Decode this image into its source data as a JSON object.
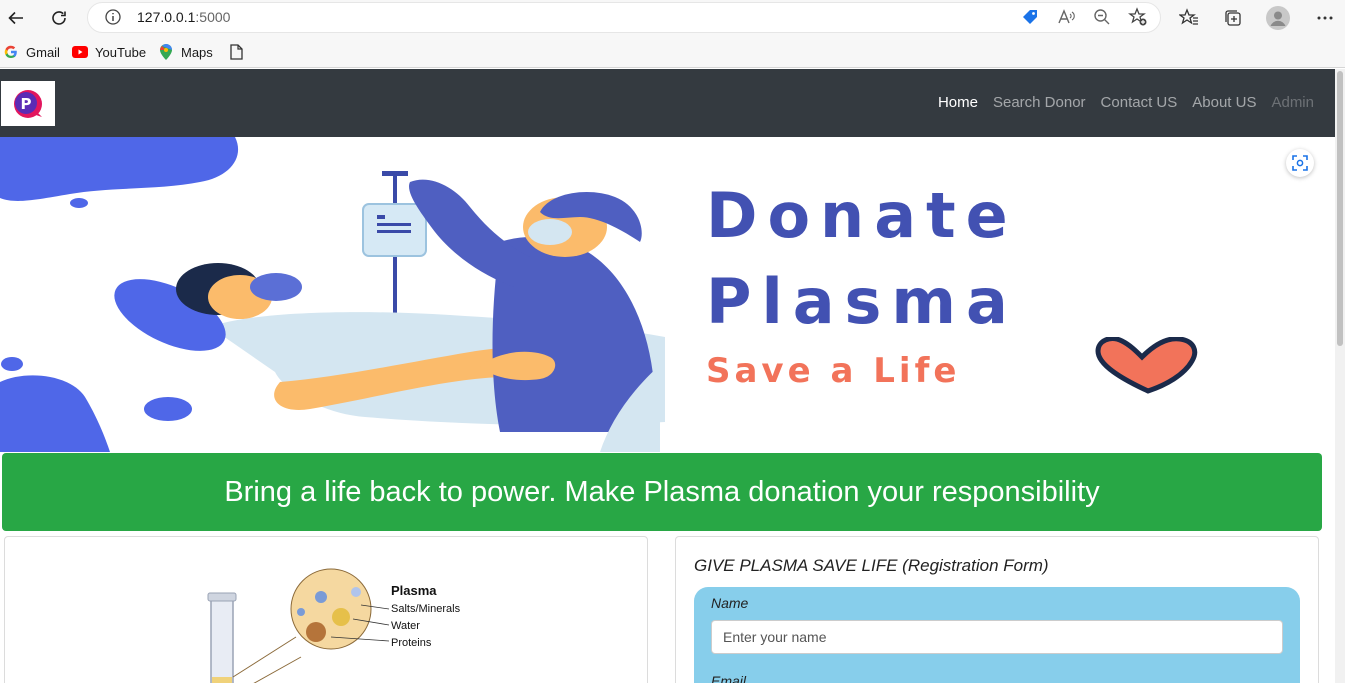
{
  "browser": {
    "url_host": "127.0.0.1",
    "url_port": ":5000",
    "bookmarks": [
      {
        "label": "Gmail",
        "icon": "google-icon"
      },
      {
        "label": "YouTube",
        "icon": "youtube-icon"
      },
      {
        "label": "Maps",
        "icon": "maps-icon"
      },
      {
        "label": "",
        "icon": "document-icon"
      }
    ]
  },
  "navbar": {
    "logo_letter": "P",
    "links": [
      {
        "label": "Home",
        "state": "active"
      },
      {
        "label": "Search Donor",
        "state": "normal"
      },
      {
        "label": "Contact US",
        "state": "normal"
      },
      {
        "label": "About US",
        "state": "normal"
      },
      {
        "label": "Admin",
        "state": "disabled"
      }
    ]
  },
  "hero": {
    "line1": "Donate",
    "line2": "Plasma",
    "line3": "Save a Life"
  },
  "banner": {
    "text": "Bring a life back to power. Make Plasma donation your responsibility"
  },
  "diagram": {
    "title": "Plasma",
    "labels": [
      "Salts/Minerals",
      "Water",
      "Proteins"
    ]
  },
  "form": {
    "title": "GIVE PLASMA SAVE LIFE (Registration Form)",
    "name_label": "Name",
    "name_placeholder": "Enter your name",
    "email_label": "Email"
  },
  "colors": {
    "navbar": "#343a40",
    "banner": "#28a745",
    "form_box": "#87ceeb",
    "hero_blue": "#4251b2",
    "hero_coral": "#f2735a"
  }
}
